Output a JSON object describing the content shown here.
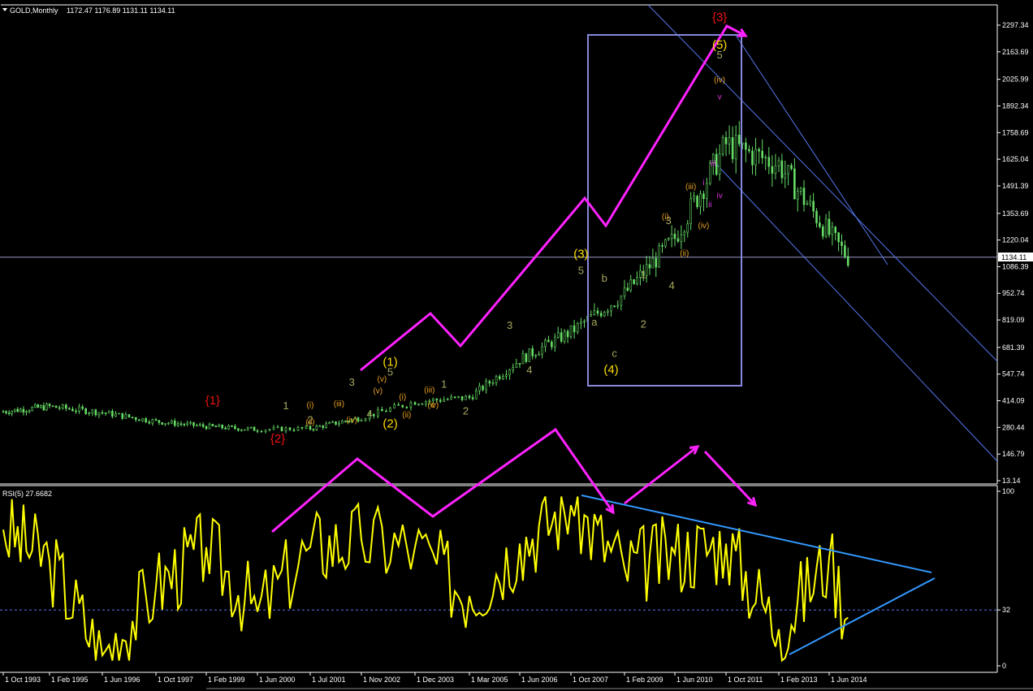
{
  "header": {
    "symbol": "GOLD,Monthly",
    "ohlc": "1172.47 1176.89 1131.11 1134.11",
    "rsi_label": "RSI(5) 27.6682"
  },
  "colors": {
    "background": "#000000",
    "candles": "#66dd66",
    "rsi": "#ffff00",
    "arrows": "#ff22ff",
    "box": "#8888dd",
    "channel": "#5577ee",
    "triangle": "#3399ff",
    "price_line": "#9999cc",
    "wave_major": "#ee1111",
    "wave_intermediate": "#ffdd00",
    "wave_primary": "#a8a860",
    "wave_minor": "#e8a020",
    "wave_minute": "#dd33dd"
  },
  "chart_data": [
    {
      "type": "candlestick",
      "title": "GOLD,Monthly",
      "ylim": [
        13.14,
        2297.34
      ],
      "y_ticks": [
        2297.34,
        2163.69,
        2025.99,
        1892.34,
        1758.69,
        1625.04,
        1491.39,
        1353.69,
        1220.04,
        1086.39,
        952.74,
        819.09,
        681.39,
        547.74,
        414.09,
        280.44,
        146.79,
        13.14
      ],
      "current_price": "1134.11",
      "x_ticks": [
        "1 Oct 1993",
        "1 Feb 1995",
        "1 Jun 1996",
        "1 Oct 1997",
        "1 Feb 1999",
        "1 Jun 2000",
        "1 Jul 2001",
        "1 Nov 2002",
        "1 Dec 2003",
        "1 Mar 2005",
        "1 Jun 2006",
        "1 Oct 2007",
        "1 Feb 2009",
        "1 Jun 2010",
        "1 Oct 2011",
        "1 Feb 2013",
        "1 Jun 2014"
      ],
      "x": [
        "1993-10",
        "1995-02",
        "1996-06",
        "1997-10",
        "1999-02",
        "2000-06",
        "2001-07",
        "2002-11",
        "2003-12",
        "2005-03",
        "2006-06",
        "2007-10",
        "2009-02",
        "2010-06",
        "2011-10",
        "2013-02",
        "2014-06",
        "2014-12"
      ],
      "close": [
        360,
        385,
        355,
        310,
        285,
        270,
        275,
        330,
        410,
        430,
        620,
        760,
        950,
        1230,
        1700,
        1600,
        1250,
        1134.11
      ],
      "wave_labels": [
        {
          "text": "{1}",
          "degree": "major",
          "x": "1999-04",
          "price": 395
        },
        {
          "text": "{2}",
          "degree": "major",
          "x": "2000-11",
          "price": 205
        },
        {
          "text": "{3}",
          "degree": "major",
          "x": "2011-08",
          "price": 2318
        },
        {
          "text": "(1)",
          "degree": "intermediate",
          "x": "2003-06",
          "price": 590
        },
        {
          "text": "(2)",
          "degree": "intermediate",
          "x": "2003-06",
          "price": 280
        },
        {
          "text": "(3)",
          "degree": "intermediate",
          "x": "2008-01",
          "price": 1130
        },
        {
          "text": "(4)",
          "degree": "intermediate",
          "x": "2008-10",
          "price": 550
        },
        {
          "text": "(5)",
          "degree": "intermediate",
          "x": "2011-08",
          "price": 2180
        },
        {
          "text": "1",
          "degree": "primary",
          "x": "2001-01",
          "price": 372
        },
        {
          "text": "2",
          "degree": "primary",
          "x": "2001-07",
          "price": 300
        },
        {
          "text": "3",
          "degree": "primary",
          "x": "2002-08",
          "price": 490
        },
        {
          "text": "4",
          "degree": "primary",
          "x": "2003-01",
          "price": 330
        },
        {
          "text": "5",
          "degree": "primary",
          "x": "2003-06",
          "price": 540
        },
        {
          "text": "1",
          "degree": "primary",
          "x": "2004-08",
          "price": 480
        },
        {
          "text": "2",
          "degree": "primary",
          "x": "2005-02",
          "price": 345
        },
        {
          "text": "3",
          "degree": "primary",
          "x": "2006-03",
          "price": 775
        },
        {
          "text": "4",
          "degree": "primary",
          "x": "2006-09",
          "price": 550
        },
        {
          "text": "5",
          "degree": "primary",
          "x": "2008-01",
          "price": 1050
        },
        {
          "text": "1",
          "degree": "primary",
          "x": "2009-08",
          "price": 1030
        },
        {
          "text": "2",
          "degree": "primary",
          "x": "2009-08",
          "price": 780
        },
        {
          "text": "3",
          "degree": "primary",
          "x": "2010-04",
          "price": 1300
        },
        {
          "text": "4",
          "degree": "primary",
          "x": "2010-05",
          "price": 975
        },
        {
          "text": "5",
          "degree": "primary",
          "x": "2011-08",
          "price": 2130
        },
        {
          "text": "a",
          "degree": "primary",
          "x": "2008-05",
          "price": 790
        },
        {
          "text": "b",
          "degree": "primary",
          "x": "2008-08",
          "price": 1010
        },
        {
          "text": "c",
          "degree": "primary",
          "x": "2008-11",
          "price": 635
        },
        {
          "text": "(i)",
          "degree": "minor",
          "x": "2001-07",
          "price": 380
        },
        {
          "text": "(ii)",
          "degree": "minor",
          "x": "2001-07",
          "price": 295
        },
        {
          "text": "(iii)",
          "degree": "minor",
          "x": "2002-04",
          "price": 385
        },
        {
          "text": "(iv)",
          "degree": "minor",
          "x": "2002-08",
          "price": 305
        },
        {
          "text": "(v)",
          "degree": "minor",
          "x": "2003-03",
          "price": 450
        },
        {
          "text": "(v)",
          "degree": "minor",
          "x": "2003-04",
          "price": 510
        },
        {
          "text": "(i)",
          "degree": "minor",
          "x": "2003-09",
          "price": 420
        },
        {
          "text": "(ii)",
          "degree": "minor",
          "x": "2003-10",
          "price": 330
        },
        {
          "text": "(iii)",
          "degree": "minor",
          "x": "2004-04",
          "price": 455
        },
        {
          "text": "(iv)",
          "degree": "minor",
          "x": "2004-05",
          "price": 380
        },
        {
          "text": "c",
          "degree": "minor",
          "x": "2004-05",
          "price": 380
        },
        {
          "text": "(i)",
          "degree": "minor",
          "x": "2010-03",
          "price": 1325
        },
        {
          "text": "(ii)",
          "degree": "minor",
          "x": "2010-09",
          "price": 1140
        },
        {
          "text": "(iii)",
          "degree": "minor",
          "x": "2010-11",
          "price": 1475
        },
        {
          "text": "(iv)",
          "degree": "minor",
          "x": "2011-03",
          "price": 1280
        },
        {
          "text": "(iv)",
          "degree": "minor",
          "x": "2011-08",
          "price": 2010
        },
        {
          "text": "i",
          "degree": "minute",
          "x": "2011-03",
          "price": 1495
        },
        {
          "text": "ii",
          "degree": "minute",
          "x": "2011-05",
          "price": 1385
        },
        {
          "text": "iii",
          "degree": "minute",
          "x": "2011-06",
          "price": 1590
        },
        {
          "text": "iv",
          "degree": "minute",
          "x": "2011-08",
          "price": 1430
        },
        {
          "text": "v",
          "degree": "minute",
          "x": "2011-08",
          "price": 1925
        }
      ]
    },
    {
      "type": "line",
      "title": "RSI(5) 27.6682",
      "ylim": [
        0,
        100
      ],
      "y_ticks": [
        100,
        32,
        0
      ],
      "reference_level": 32,
      "x": [
        "1993-10",
        "1995-02",
        "1996-06",
        "1997-10",
        "1999-02",
        "2000-06",
        "2001-07",
        "2002-11",
        "2003-12",
        "2005-03",
        "2006-06",
        "2007-10",
        "2009-02",
        "2010-06",
        "2011-10",
        "2013-02",
        "2014-06",
        "2014-12"
      ],
      "values": [
        78,
        60,
        6,
        45,
        68,
        31,
        68,
        72,
        68,
        40,
        70,
        92,
        56,
        64,
        70,
        21,
        62,
        27.67
      ]
    }
  ]
}
